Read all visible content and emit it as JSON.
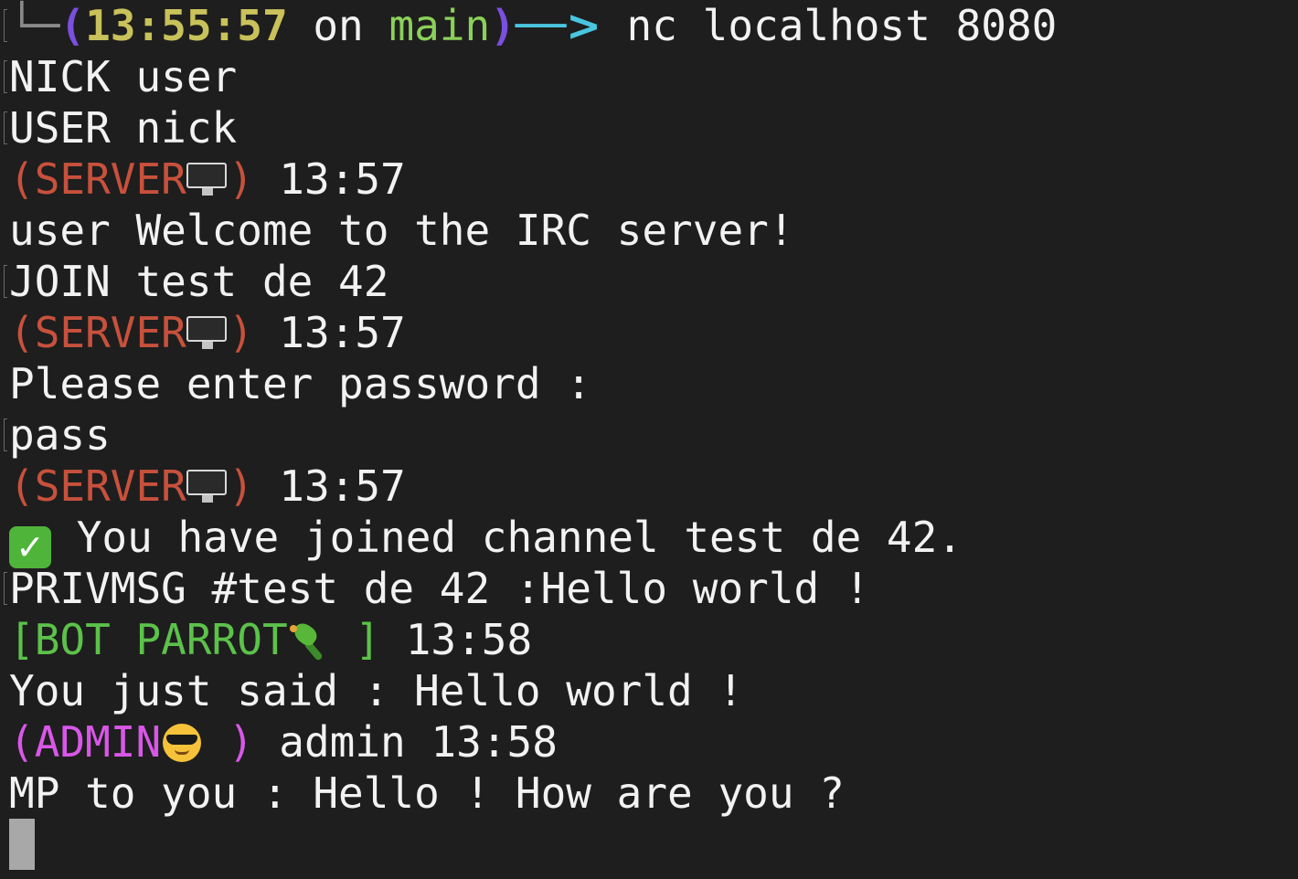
{
  "terminal": {
    "prompt": {
      "corner": "└─",
      "open": "(",
      "time": "13:55:57",
      "on": " on ",
      "branch": "main",
      "close": ")",
      "arrow": "──>",
      "command": " nc localhost 8080"
    },
    "input_nick": "NICK user",
    "input_user": "USER nick",
    "server_label": "(SERVER",
    "server_label_close": ")",
    "server_time_1": " 13:57",
    "welcome": "user Welcome to the IRC server!",
    "input_join": "JOIN test de 42",
    "server_time_2": " 13:57",
    "password_prompt": "Please enter password :",
    "input_pass": "pass",
    "server_time_3": " 13:57",
    "joined_message": " You have joined channel test de 42.",
    "input_privmsg": "PRIVMSG #test de 42 :Hello world !",
    "bot_label": "[BOT PARROT",
    "bot_label_close": " ]",
    "bot_time": " 13:58",
    "bot_reply": "You just said : Hello world !",
    "admin_label": "(ADMIN",
    "admin_label_close": " )",
    "admin_info": " admin 13:58",
    "admin_message": "MP to you : Hello ! How are you ?"
  },
  "icons": {
    "server": "monitor-icon",
    "joined": "checkmark-icon",
    "bot": "parrot-icon",
    "admin": "sunglasses-face-icon"
  },
  "colors": {
    "background": "#1e1e1e",
    "server": "#c8513c",
    "bot": "#5cc24a",
    "admin": "#d957e8",
    "prompt_time": "#c9c15a",
    "prompt_paren": "#7b4fe0",
    "branch": "#8bd05a",
    "arrow": "#49c6e0"
  }
}
